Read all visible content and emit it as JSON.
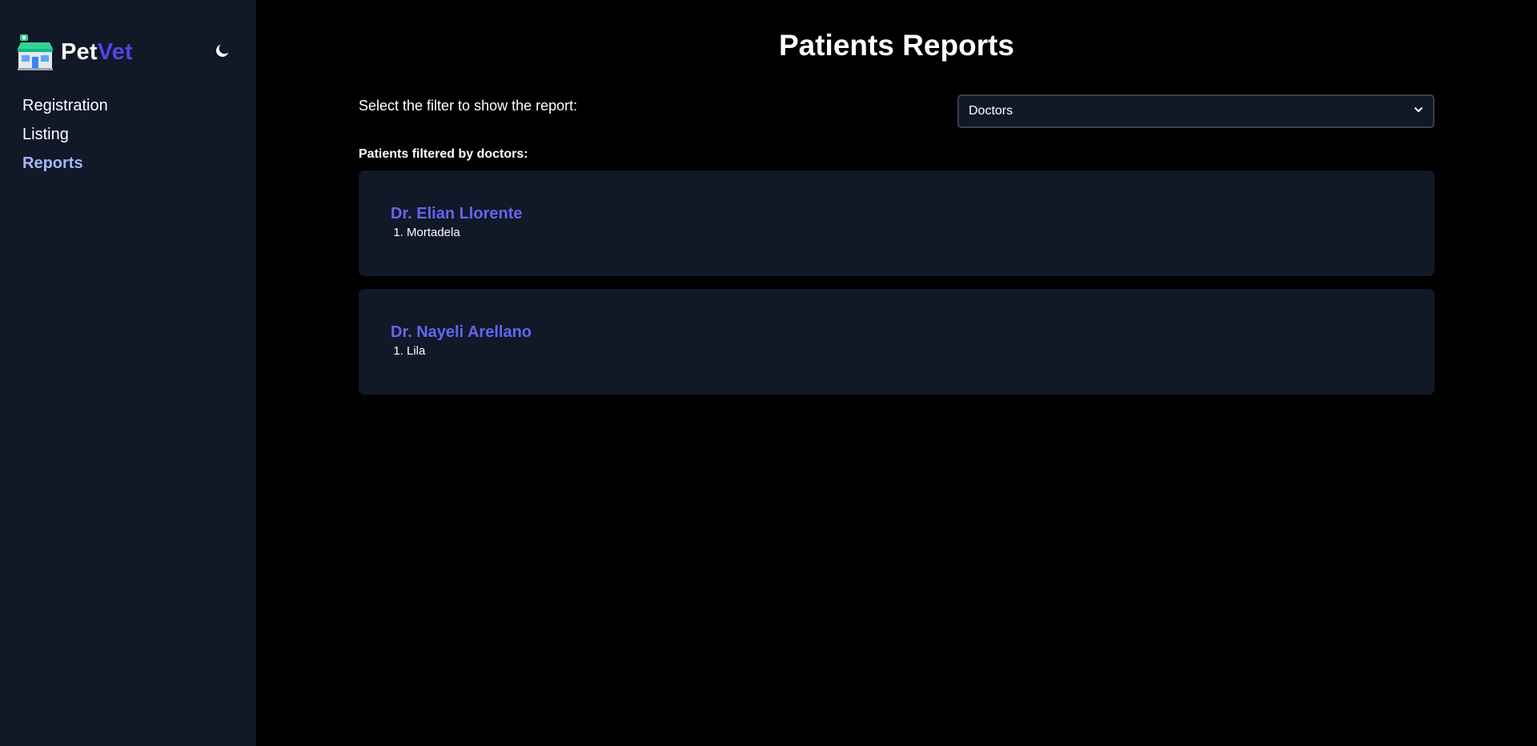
{
  "brand": {
    "name_part1": "Pet",
    "name_part2": "Vet",
    "accent_color": "#4f46e5"
  },
  "theme_toggle": {
    "icon": "moon-icon"
  },
  "nav": {
    "items": [
      {
        "label": "Registration",
        "active": false
      },
      {
        "label": "Listing",
        "active": false
      },
      {
        "label": "Reports",
        "active": true
      }
    ]
  },
  "page": {
    "title": "Patients Reports"
  },
  "filter": {
    "label": "Select the filter to show the report:",
    "selected": "Doctors"
  },
  "results": {
    "heading": "Patients filtered by doctors:",
    "doctors": [
      {
        "name": "Dr. Elian Llorente",
        "patients": [
          "Mortadela"
        ]
      },
      {
        "name": "Dr. Nayeli Arellano",
        "patients": [
          "Lila"
        ]
      }
    ]
  },
  "colors": {
    "sidebar_bg": "#111827",
    "page_bg": "#000000",
    "card_bg": "#111827",
    "doctor_name": "#6366f1",
    "active_nav": "#a5b4fc"
  }
}
